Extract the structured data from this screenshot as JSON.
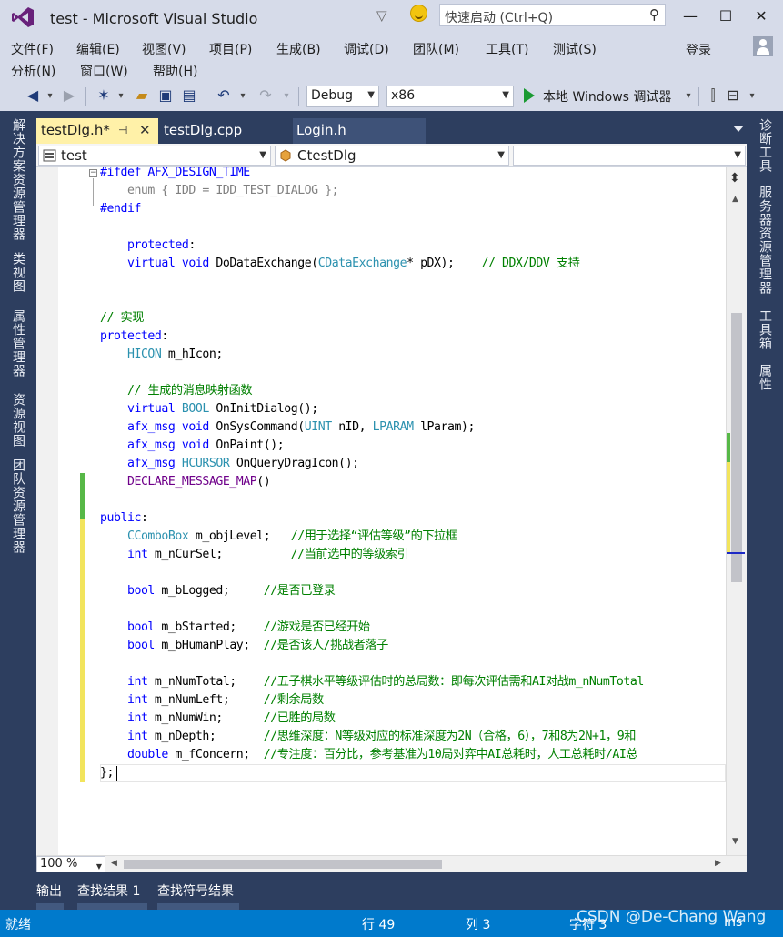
{
  "window": {
    "title": "test - Microsoft Visual Studio",
    "quick_launch_placeholder": "快速启动 (Ctrl+Q)",
    "minimize": "—",
    "maximize": "☐",
    "close": "✕"
  },
  "menu": {
    "row1": [
      "文件(F)",
      "编辑(E)",
      "视图(V)",
      "项目(P)",
      "生成(B)",
      "调试(D)",
      "团队(M)",
      "工具(T)",
      "测试(S)"
    ],
    "row2": [
      "分析(N)",
      "窗口(W)",
      "帮助(H)"
    ],
    "login": "登录"
  },
  "toolbar": {
    "config": "Debug",
    "platform": "x86",
    "run_label": "本地 Windows 调试器",
    "icons": [
      "back-icon",
      "forward-icon",
      "new-project-icon",
      "open-icon",
      "save-icon",
      "save-all-icon",
      "undo-icon",
      "redo-icon",
      "start-icon",
      "toolbar-extra-icon"
    ]
  },
  "left_rail": {
    "tabs": [
      "解决方案资源管理器",
      "类视图",
      "属性管理器",
      "资源视图",
      "团队资源管理器"
    ]
  },
  "right_rail": {
    "tabs": [
      "诊断工具",
      "服务器资源管理器",
      "工具箱",
      "属性"
    ]
  },
  "tabs": {
    "active": "testDlg.h*",
    "second": "testDlg.cpp",
    "third": "Login.h",
    "pin": "⊣",
    "close": "✕"
  },
  "navbar": {
    "project": "test",
    "class": "CtestDlg",
    "member": ""
  },
  "editor": {
    "lines": [
      [
        {
          "t": "#ifdef AFX_DESIGN_TIME",
          "c": "pp"
        }
      ],
      [
        {
          "t": "    enum { IDD = IDD_TEST_DIALOG };",
          "c": "gr"
        }
      ],
      [
        {
          "t": "#endif",
          "c": "pp"
        }
      ],
      [
        {
          "t": "",
          "c": ""
        }
      ],
      [
        {
          "t": "    ",
          "c": ""
        },
        {
          "t": "protected",
          "c": "kw"
        },
        {
          "t": ":",
          "c": ""
        }
      ],
      [
        {
          "t": "    ",
          "c": ""
        },
        {
          "t": "virtual",
          "c": "kw"
        },
        {
          "t": " ",
          "c": ""
        },
        {
          "t": "void",
          "c": "kw"
        },
        {
          "t": " DoDataExchange(",
          "c": ""
        },
        {
          "t": "CDataExchange",
          "c": "ty"
        },
        {
          "t": "* pDX);    ",
          "c": ""
        },
        {
          "t": "// DDX/DDV 支持",
          "c": "cm"
        }
      ],
      [
        {
          "t": "",
          "c": ""
        }
      ],
      [
        {
          "t": "",
          "c": ""
        }
      ],
      [
        {
          "t": "// 实现",
          "c": "cm"
        }
      ],
      [
        {
          "t": "protected",
          "c": "kw"
        },
        {
          "t": ":",
          "c": ""
        }
      ],
      [
        {
          "t": "    ",
          "c": ""
        },
        {
          "t": "HICON",
          "c": "ty"
        },
        {
          "t": " m_hIcon;",
          "c": ""
        }
      ],
      [
        {
          "t": "",
          "c": ""
        }
      ],
      [
        {
          "t": "    ",
          "c": ""
        },
        {
          "t": "// 生成的消息映射函数",
          "c": "cm"
        }
      ],
      [
        {
          "t": "    ",
          "c": ""
        },
        {
          "t": "virtual",
          "c": "kw"
        },
        {
          "t": " ",
          "c": ""
        },
        {
          "t": "BOOL",
          "c": "ty"
        },
        {
          "t": " OnInitDialog();",
          "c": ""
        }
      ],
      [
        {
          "t": "    ",
          "c": ""
        },
        {
          "t": "afx_msg",
          "c": "kw"
        },
        {
          "t": " ",
          "c": ""
        },
        {
          "t": "void",
          "c": "kw"
        },
        {
          "t": " OnSysCommand(",
          "c": ""
        },
        {
          "t": "UINT",
          "c": "ty"
        },
        {
          "t": " nID, ",
          "c": ""
        },
        {
          "t": "LPARAM",
          "c": "ty"
        },
        {
          "t": " lParam);",
          "c": ""
        }
      ],
      [
        {
          "t": "    ",
          "c": ""
        },
        {
          "t": "afx_msg",
          "c": "kw"
        },
        {
          "t": " ",
          "c": ""
        },
        {
          "t": "void",
          "c": "kw"
        },
        {
          "t": " OnPaint();",
          "c": ""
        }
      ],
      [
        {
          "t": "    ",
          "c": ""
        },
        {
          "t": "afx_msg",
          "c": "kw"
        },
        {
          "t": " ",
          "c": ""
        },
        {
          "t": "HCURSOR",
          "c": "ty"
        },
        {
          "t": " OnQueryDragIcon();",
          "c": ""
        }
      ],
      [
        {
          "t": "    ",
          "c": ""
        },
        {
          "t": "DECLARE_MESSAGE_MAP",
          "c": "mc"
        },
        {
          "t": "()",
          "c": ""
        }
      ],
      [
        {
          "t": "",
          "c": ""
        }
      ],
      [
        {
          "t": "public",
          "c": "kw"
        },
        {
          "t": ":",
          "c": ""
        }
      ],
      [
        {
          "t": "    ",
          "c": ""
        },
        {
          "t": "CComboBox",
          "c": "ty"
        },
        {
          "t": " m_objLevel;   ",
          "c": ""
        },
        {
          "t": "//用于选择“评估等级”的下拉框",
          "c": "cm"
        }
      ],
      [
        {
          "t": "    ",
          "c": ""
        },
        {
          "t": "int",
          "c": "kw"
        },
        {
          "t": " m_nCurSel;          ",
          "c": ""
        },
        {
          "t": "//当前选中的等级索引",
          "c": "cm"
        }
      ],
      [
        {
          "t": "",
          "c": ""
        }
      ],
      [
        {
          "t": "    ",
          "c": ""
        },
        {
          "t": "bool",
          "c": "kw"
        },
        {
          "t": " m_bLogged;     ",
          "c": ""
        },
        {
          "t": "//是否已登录",
          "c": "cm"
        }
      ],
      [
        {
          "t": "",
          "c": ""
        }
      ],
      [
        {
          "t": "    ",
          "c": ""
        },
        {
          "t": "bool",
          "c": "kw"
        },
        {
          "t": " m_bStarted;    ",
          "c": ""
        },
        {
          "t": "//游戏是否已经开始",
          "c": "cm"
        }
      ],
      [
        {
          "t": "    ",
          "c": ""
        },
        {
          "t": "bool",
          "c": "kw"
        },
        {
          "t": " m_bHumanPlay;  ",
          "c": ""
        },
        {
          "t": "//是否该人/挑战者落子",
          "c": "cm"
        }
      ],
      [
        {
          "t": "",
          "c": ""
        }
      ],
      [
        {
          "t": "    ",
          "c": ""
        },
        {
          "t": "int",
          "c": "kw"
        },
        {
          "t": " m_nNumTotal;    ",
          "c": ""
        },
        {
          "t": "//五子棋水平等级评估时的总局数：即每次评估需和AI对战m_nNumTotal",
          "c": "cm"
        }
      ],
      [
        {
          "t": "    ",
          "c": ""
        },
        {
          "t": "int",
          "c": "kw"
        },
        {
          "t": " m_nNumLeft;     ",
          "c": ""
        },
        {
          "t": "//剩余局数",
          "c": "cm"
        }
      ],
      [
        {
          "t": "    ",
          "c": ""
        },
        {
          "t": "int",
          "c": "kw"
        },
        {
          "t": " m_nNumWin;      ",
          "c": ""
        },
        {
          "t": "//已胜的局数",
          "c": "cm"
        }
      ],
      [
        {
          "t": "    ",
          "c": ""
        },
        {
          "t": "int",
          "c": "kw"
        },
        {
          "t": " m_nDepth;       ",
          "c": ""
        },
        {
          "t": "//思维深度：N等级对应的标准深度为2N（合格，6），7和8为2N+1，9和",
          "c": "cm"
        }
      ],
      [
        {
          "t": "    ",
          "c": ""
        },
        {
          "t": "double",
          "c": "kw"
        },
        {
          "t": " m_fConcern;  ",
          "c": ""
        },
        {
          "t": "//专注度：百分比，参考基准为10局对弈中AI总耗时，人工总耗时/AI总",
          "c": "cm"
        }
      ],
      [
        {
          "t": "};",
          "c": ""
        }
      ]
    ]
  },
  "zoom": "100 %",
  "bottom_tabs": [
    "输出",
    "查找结果 1",
    "查找符号结果"
  ],
  "status": {
    "ready": "就绪",
    "line": "行 49",
    "col": "列 3",
    "char": "字符 3",
    "mode": "Ins"
  },
  "watermark": "CSDN @De-Chang Wang",
  "colors": {
    "chrome": "#d6dbe9",
    "dark": "#2d3e5f",
    "status": "#007acc",
    "active_tab": "#fff1a8",
    "keyword": "#0000ff",
    "type": "#2b91af",
    "comment": "#008000",
    "macro": "#6f008a",
    "change_saved": "#57b847",
    "change_unsaved": "#f2e45c"
  }
}
